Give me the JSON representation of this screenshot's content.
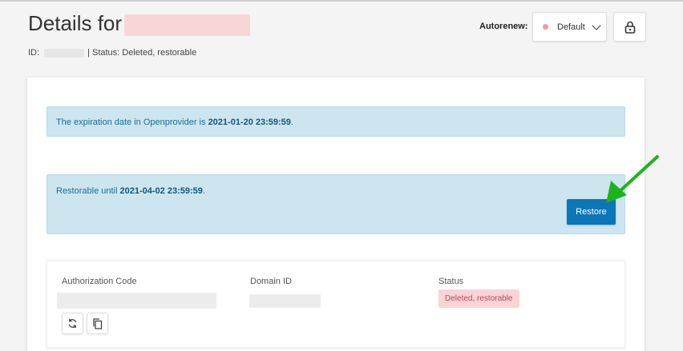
{
  "header": {
    "title_prefix": "Details for",
    "id_label": "ID:",
    "status_line": "| Status: Deleted, restorable"
  },
  "autorenew": {
    "label": "Autorenew:",
    "value": "Default",
    "dot_color": "#f19a9c"
  },
  "icons": {
    "lock": "lock-icon",
    "refresh": "refresh-icon",
    "copy": "copy-icon",
    "chevron": "chevron-down-icon"
  },
  "alerts": {
    "expiry_text": "The expiration date in Openprovider is ",
    "expiry_date": "2021-01-20 23:59:59",
    "expiry_suffix": ".",
    "restore_text": "Restorable until ",
    "restore_date": "2021-04-02 23:59:59",
    "restore_suffix": "."
  },
  "restore_button": {
    "label": "Restore"
  },
  "details": {
    "auth_code_label": "Authorization Code",
    "domain_id_label": "Domain ID",
    "status_label": "Status",
    "status_value": "Deleted, restorable"
  },
  "colors": {
    "accent": "#0b76b8",
    "alert_bg": "#cce5ef",
    "badge_bg": "#f8d4d6",
    "annotation_arrow": "#1db31d"
  }
}
